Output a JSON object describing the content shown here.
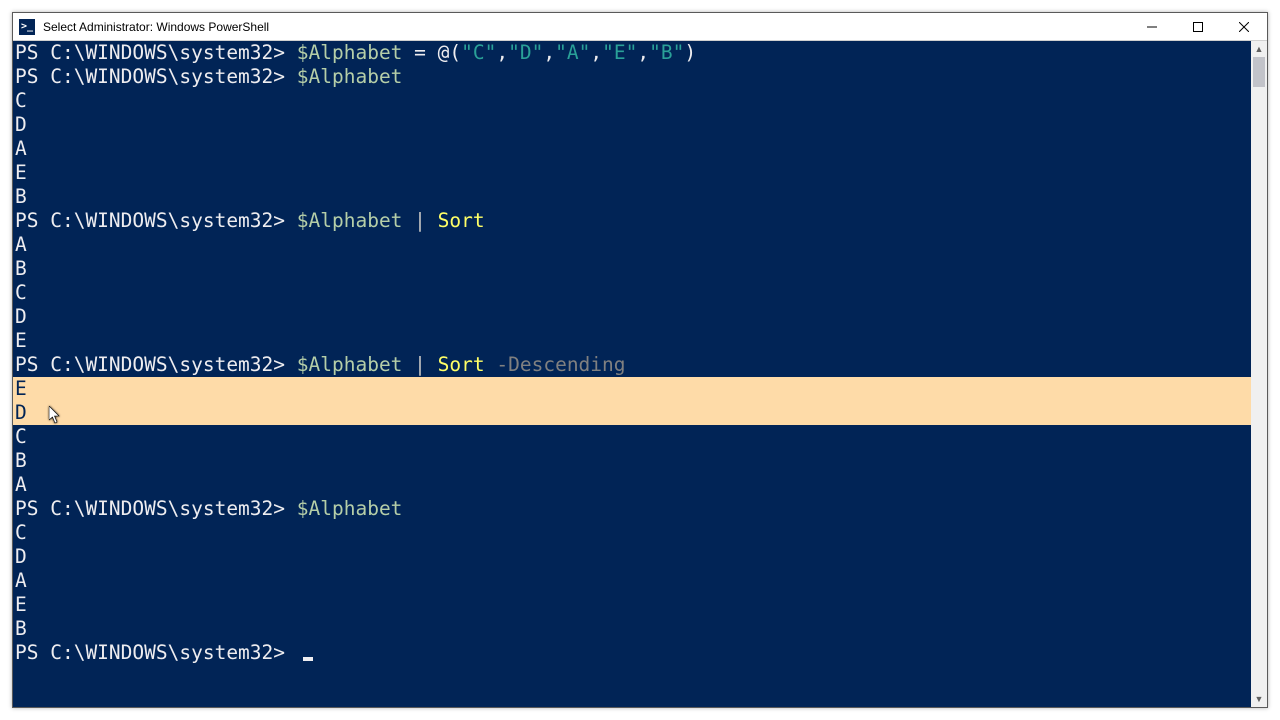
{
  "window": {
    "title": "Select Administrator: Windows PowerShell",
    "icon_label": ">_"
  },
  "prompt": "PS C:\\WINDOWS\\system32> ",
  "commands": {
    "assign": {
      "var": "$Alphabet",
      "eq": " = ",
      "open": "@(",
      "items": [
        "\"C\"",
        "\"D\"",
        "\"A\"",
        "\"E\"",
        "\"B\""
      ],
      "sep": ",",
      "close": ")"
    },
    "echo_var": "$Alphabet",
    "sort_cmd": {
      "var": "$Alphabet",
      "pipe": " | ",
      "cmd": "Sort"
    },
    "sort_desc_cmd": {
      "var": "$Alphabet",
      "pipe": " | ",
      "cmd": "Sort",
      "flag": " -Descending"
    }
  },
  "outputs": {
    "unsorted": [
      "C",
      "D",
      "A",
      "E",
      "B"
    ],
    "sorted_asc": [
      "A",
      "B",
      "C",
      "D",
      "E"
    ],
    "sorted_desc": [
      "E",
      "D",
      "C",
      "B",
      "A"
    ]
  },
  "selection": {
    "start_line_desc": 0,
    "end_line_desc": 1
  }
}
